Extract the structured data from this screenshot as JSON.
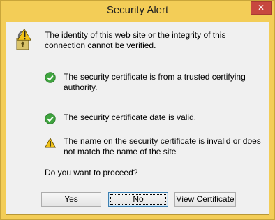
{
  "window": {
    "title": "Security Alert",
    "close_glyph": "✕",
    "colors": {
      "frame": "#f3cd57",
      "client": "#f0f0f0",
      "close": "#c7483f"
    }
  },
  "header": {
    "icon": "lock-warning-icon",
    "text": "The identity of this web site or the integrity of this connection cannot be verified."
  },
  "checks": [
    {
      "status": "ok",
      "icon": "check-circle-icon",
      "text": "The security certificate is from a trusted certifying authority."
    },
    {
      "status": "ok",
      "icon": "check-circle-icon",
      "text": "The security certificate date is valid."
    },
    {
      "status": "warning",
      "icon": "warning-triangle-icon",
      "text": "The name on the security certificate is invalid or does not match the name of the site"
    }
  ],
  "prompt": "Do you want to proceed?",
  "buttons": {
    "yes_first": "Y",
    "yes_rest": "es",
    "no_first": "N",
    "no_rest": "o",
    "view_first": "V",
    "view_rest": "iew Certificate"
  }
}
